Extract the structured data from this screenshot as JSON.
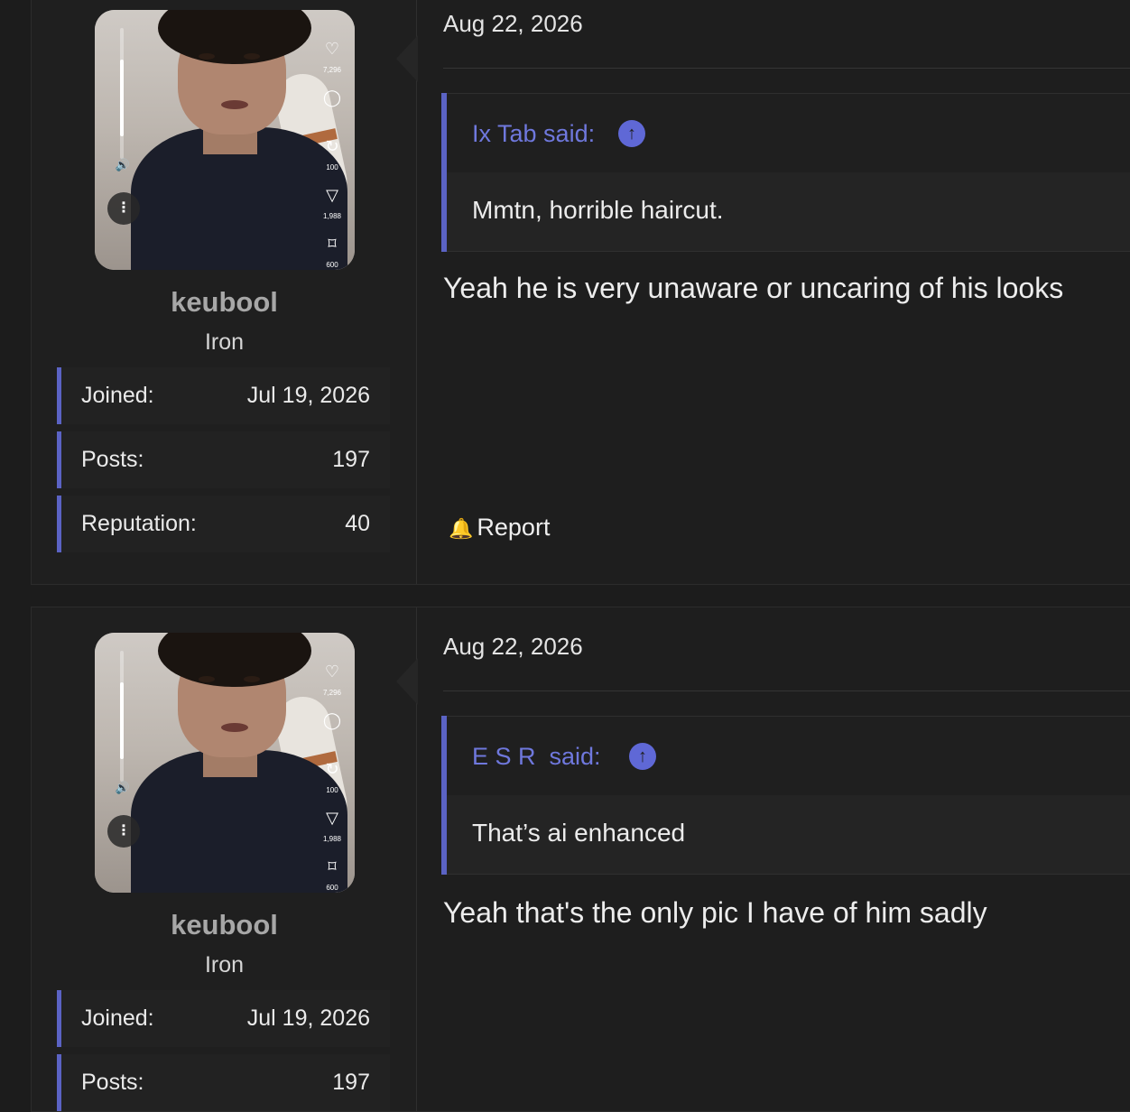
{
  "posts": [
    {
      "user": {
        "name": "keubool",
        "rank": "Iron",
        "avatar_counts": {
          "likes": "7,296",
          "shares": "1,988",
          "saves": "600",
          "reposts": "100"
        },
        "stats": [
          {
            "label": "Joined:",
            "value": "Jul 19, 2026"
          },
          {
            "label": "Posts:",
            "value": "197"
          },
          {
            "label": "Reputation:",
            "value": "40"
          }
        ]
      },
      "date": "Aug 22, 2026",
      "quote": {
        "author": "Ix Tab said:",
        "text": "Mmtn, horrible haircut."
      },
      "reply": "Yeah he is very unaware or uncaring of his looks",
      "report_label": "Report"
    },
    {
      "user": {
        "name": "keubool",
        "rank": "Iron",
        "avatar_counts": {
          "likes": "7,296",
          "shares": "1,988",
          "saves": "600",
          "reposts": "100"
        },
        "stats": [
          {
            "label": "Joined:",
            "value": "Jul 19, 2026"
          },
          {
            "label": "Posts:",
            "value": "197"
          }
        ]
      },
      "date": "Aug 22, 2026",
      "quote": {
        "author": "E S R  said:",
        "text": "That’s ai enhanced"
      },
      "reply": "Yeah that's the only pic I have of him sadly"
    }
  ],
  "colors": {
    "accent": "#5b63c4",
    "quote_author": "#6f78dd",
    "background": "#1c1c1c"
  },
  "icons": {
    "quote_link": "arrow-up-circle-icon",
    "report": "bell-icon"
  }
}
